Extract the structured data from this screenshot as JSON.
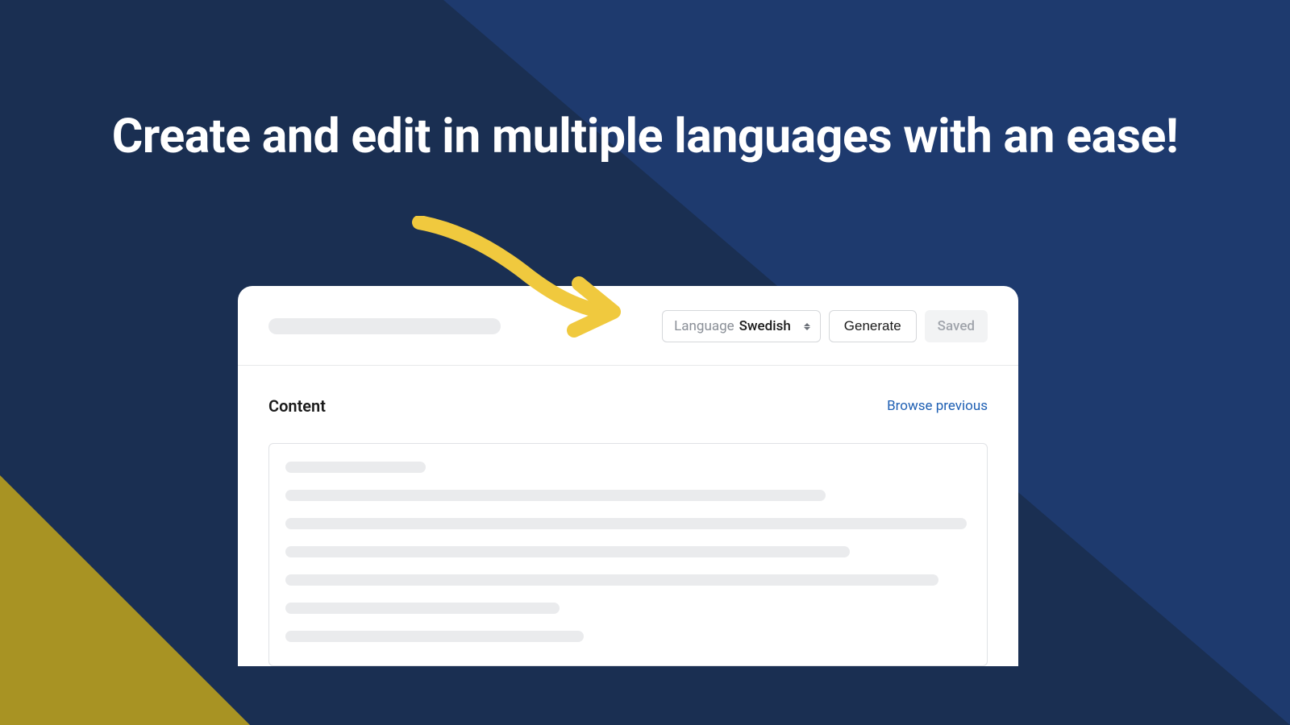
{
  "headline": "Create and edit in multiple languages with an ease!",
  "toolbar": {
    "language_label": "Language",
    "language_value": "Swedish",
    "generate_label": "Generate",
    "saved_label": "Saved"
  },
  "content": {
    "section_title": "Content",
    "browse_label": "Browse previous"
  }
}
